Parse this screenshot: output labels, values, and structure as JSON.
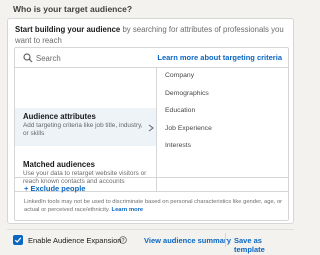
{
  "header": {
    "title": "Who is your target audience?"
  },
  "intro": {
    "bold": "Start building your audience",
    "rest": " by searching for attributes of professionals you want to reach"
  },
  "search": {
    "placeholder": "Search",
    "value": ""
  },
  "learn_link": "Learn more about targeting criteria",
  "left_items": [
    {
      "title": "Audience attributes",
      "desc": "Add targeting criteria like job title, industry, or skills",
      "selected": true
    },
    {
      "title": "Matched audiences",
      "desc": "Use your data to retarget website visitors or reach known contacts and accounts",
      "selected": false
    }
  ],
  "facets": [
    "Company",
    "Demographics",
    "Education",
    "Job Experience",
    "Interests"
  ],
  "exclude": {
    "label": "+ Exclude people"
  },
  "disclaimer": {
    "text": "LinkedIn tools may not be used to discriminate based on personal characteristics like gender, age, or actual or perceived race/ethnicity. ",
    "more": "Learn more"
  },
  "footer": {
    "checkbox_checked": true,
    "expansion_label": "Enable Audience Expansion",
    "view_summary": "View audience summary",
    "save_template": "Save as template"
  },
  "colors": {
    "accent": "#0a66c2",
    "selected_bg": "#eef3f8",
    "page_bg": "#f3f2ef"
  }
}
